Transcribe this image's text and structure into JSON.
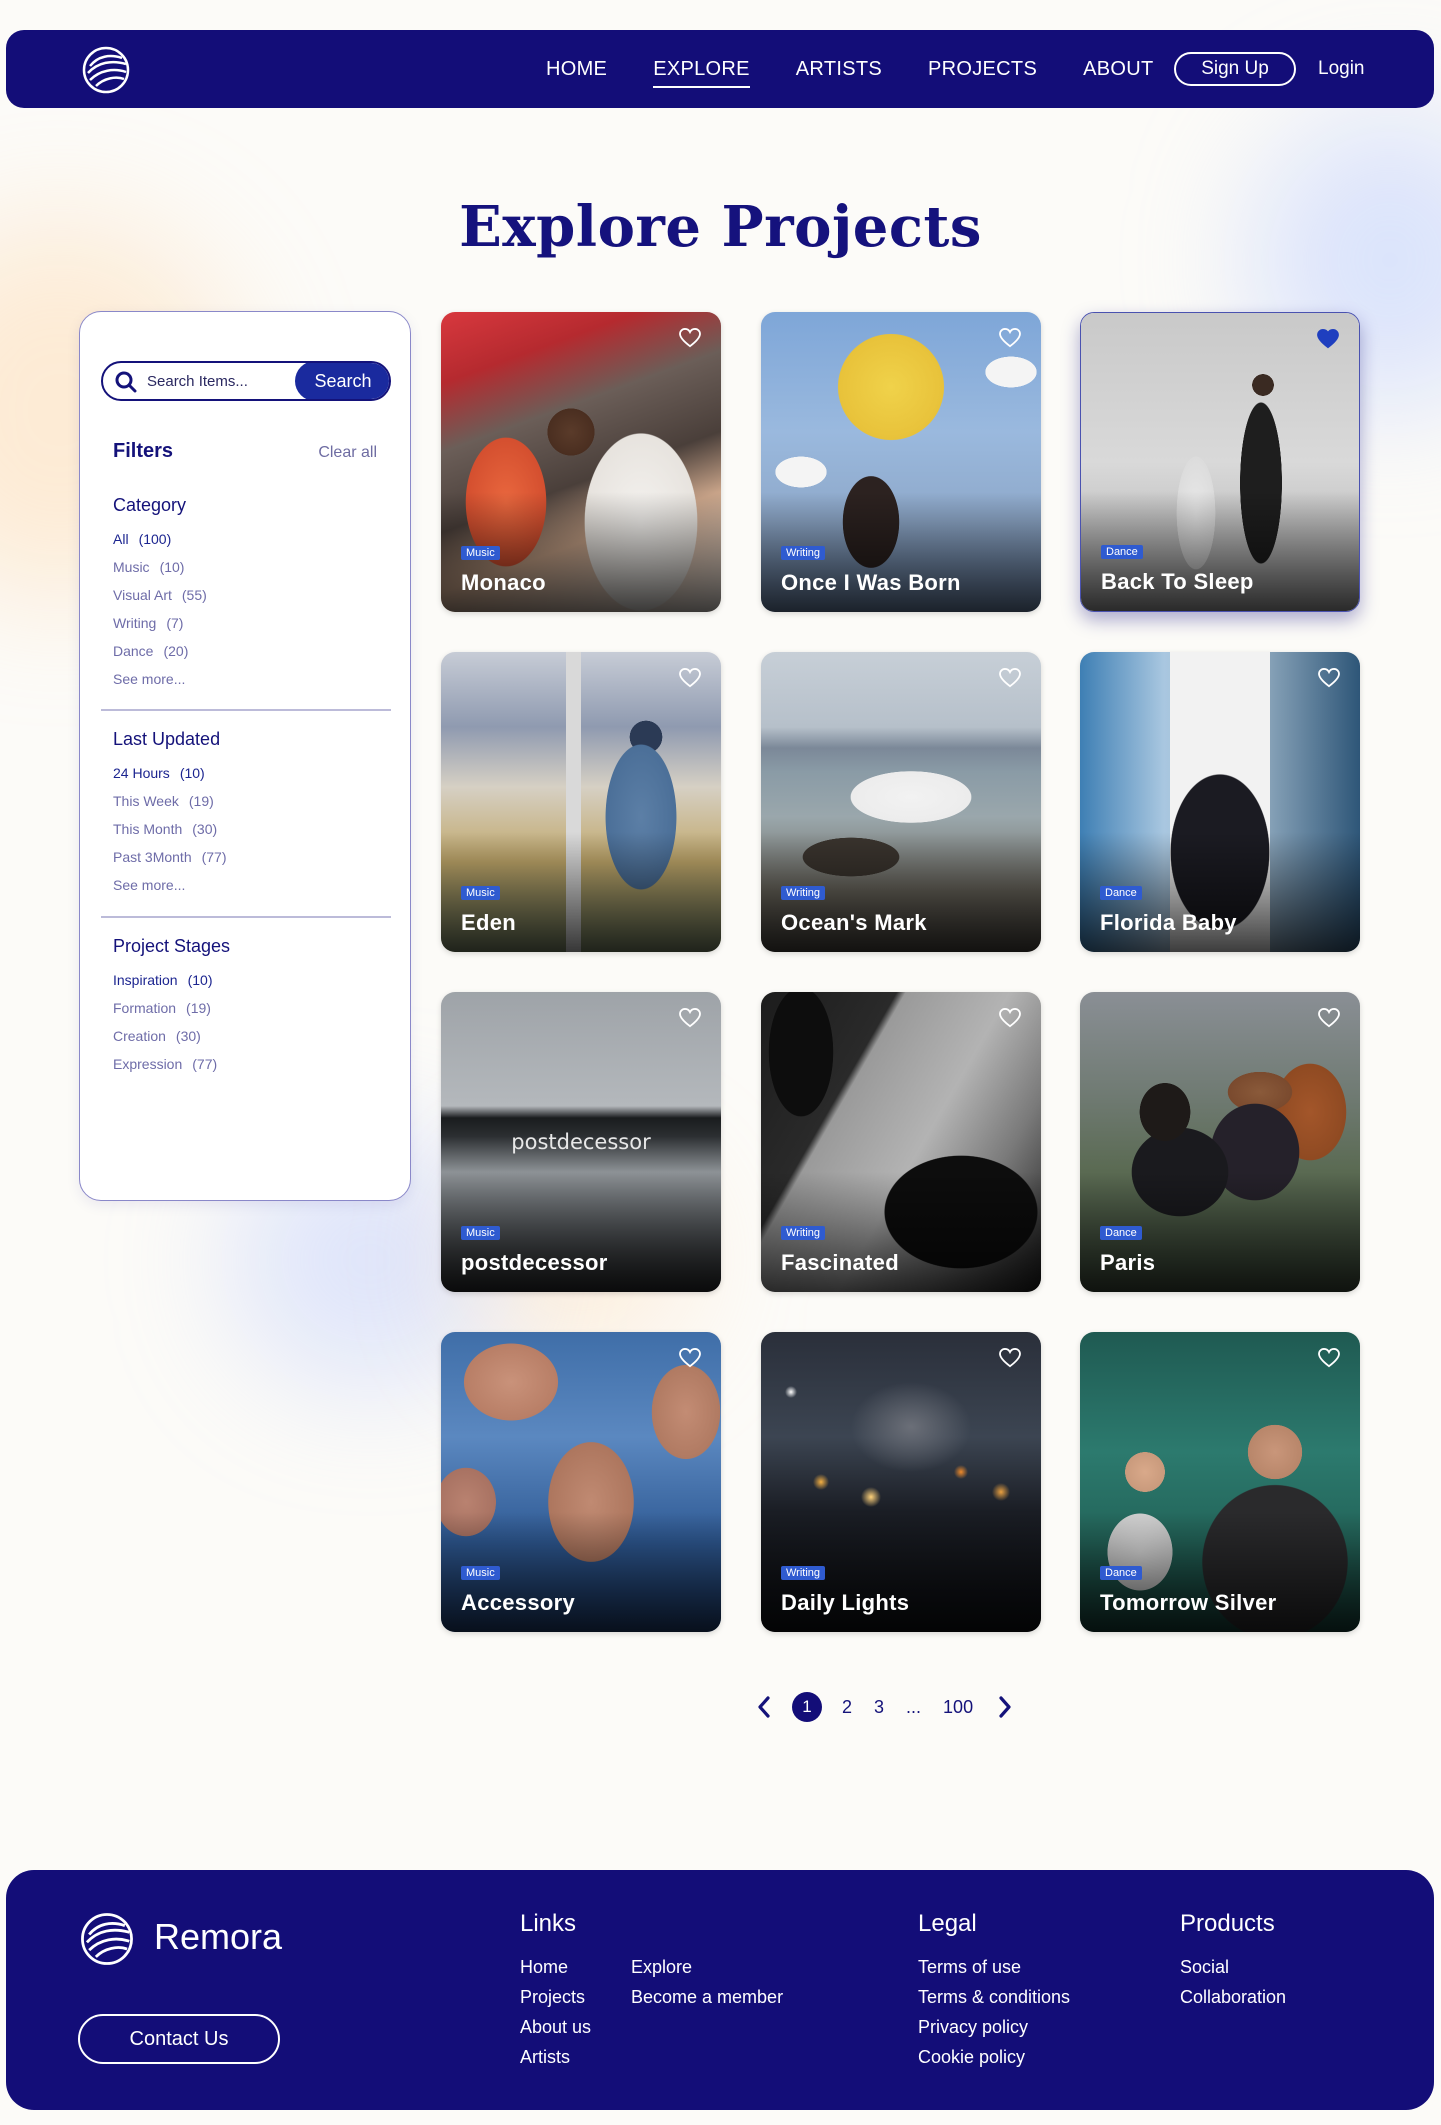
{
  "nav": {
    "items": [
      {
        "label": "HOME",
        "active": false
      },
      {
        "label": "EXPLORE",
        "active": true
      },
      {
        "label": "ARTISTS",
        "active": false
      },
      {
        "label": "PROJECTS",
        "active": false
      },
      {
        "label": "ABOUT",
        "active": false
      }
    ],
    "signup_label": "Sign Up",
    "login_label": "Login",
    "logo_icon": "wave-logo-icon"
  },
  "page_title": "Explore Projects",
  "search": {
    "placeholder": "Search Items...",
    "button_label": "Search"
  },
  "filters": {
    "title": "Filters",
    "clear_label": "Clear all",
    "groups": {
      "category": {
        "title": "Category",
        "items": [
          {
            "label": "All",
            "count": "(100)",
            "active": true
          },
          {
            "label": "Music",
            "count": "(10)",
            "active": false
          },
          {
            "label": "Visual Art",
            "count": "(55)",
            "active": false
          },
          {
            "label": "Writing",
            "count": "(7)",
            "active": false
          },
          {
            "label": "Dance",
            "count": "(20)",
            "active": false
          }
        ],
        "more_label": "See more..."
      },
      "last_updated": {
        "title": "Last Updated",
        "items": [
          {
            "label": "24 Hours",
            "count": "(10)",
            "active": true
          },
          {
            "label": "This Week",
            "count": "(19)",
            "active": false
          },
          {
            "label": "This Month",
            "count": "(30)",
            "active": false
          },
          {
            "label": "Past 3Month",
            "count": "(77)",
            "active": false
          }
        ],
        "more_label": "See more..."
      },
      "project_stages": {
        "title": "Project Stages",
        "items": [
          {
            "label": "Inspiration",
            "count": "(10)",
            "active": true
          },
          {
            "label": "Formation",
            "count": "(19)",
            "active": false
          },
          {
            "label": "Creation",
            "count": "(30)",
            "active": false
          },
          {
            "label": "Expression",
            "count": "(77)",
            "active": false
          }
        ]
      }
    }
  },
  "cards": [
    {
      "title": "Monaco",
      "tag": "Music",
      "favorited": false,
      "selected": false
    },
    {
      "title": "Once I Was Born",
      "tag": "Writing",
      "favorited": false,
      "selected": false
    },
    {
      "title": "Back To Sleep",
      "tag": "Dance",
      "favorited": true,
      "selected": true
    },
    {
      "title": "Eden",
      "tag": "Music",
      "favorited": false,
      "selected": false
    },
    {
      "title": "Ocean's Mark",
      "tag": "Writing",
      "favorited": false,
      "selected": false
    },
    {
      "title": "Florida Baby",
      "tag": "Dance",
      "favorited": false,
      "selected": false
    },
    {
      "title": "postdecessor",
      "tag": "Music",
      "favorited": false,
      "selected": false,
      "art_text": "postdecessor"
    },
    {
      "title": "Fascinated",
      "tag": "Writing",
      "favorited": false,
      "selected": false
    },
    {
      "title": "Paris",
      "tag": "Dance",
      "favorited": false,
      "selected": false
    },
    {
      "title": "Accessory",
      "tag": "Music",
      "favorited": false,
      "selected": false
    },
    {
      "title": "Daily Lights",
      "tag": "Writing",
      "favorited": false,
      "selected": false
    },
    {
      "title": "Tomorrow Silver",
      "tag": "Dance",
      "favorited": false,
      "selected": false
    }
  ],
  "pagination": {
    "current": "1",
    "pages": [
      "2",
      "3",
      "...",
      "100"
    ]
  },
  "footer": {
    "brand": "Remora",
    "contact_label": "Contact Us",
    "links": {
      "title": "Links",
      "col1": [
        "Home",
        "Projects",
        "About us",
        "Artists"
      ],
      "col2": [
        "Explore",
        "Become a member"
      ]
    },
    "legal": {
      "title": "Legal",
      "items": [
        "Terms of use",
        "Terms & conditions",
        "Privacy policy",
        "Cookie policy"
      ]
    },
    "products": {
      "title": "Products",
      "items": [
        "Social",
        "Collaboration"
      ]
    }
  },
  "colors": {
    "brand_navy": "#130d78",
    "accent_blue": "#1a2a9e",
    "tag_blue": "#2f5bd0"
  }
}
